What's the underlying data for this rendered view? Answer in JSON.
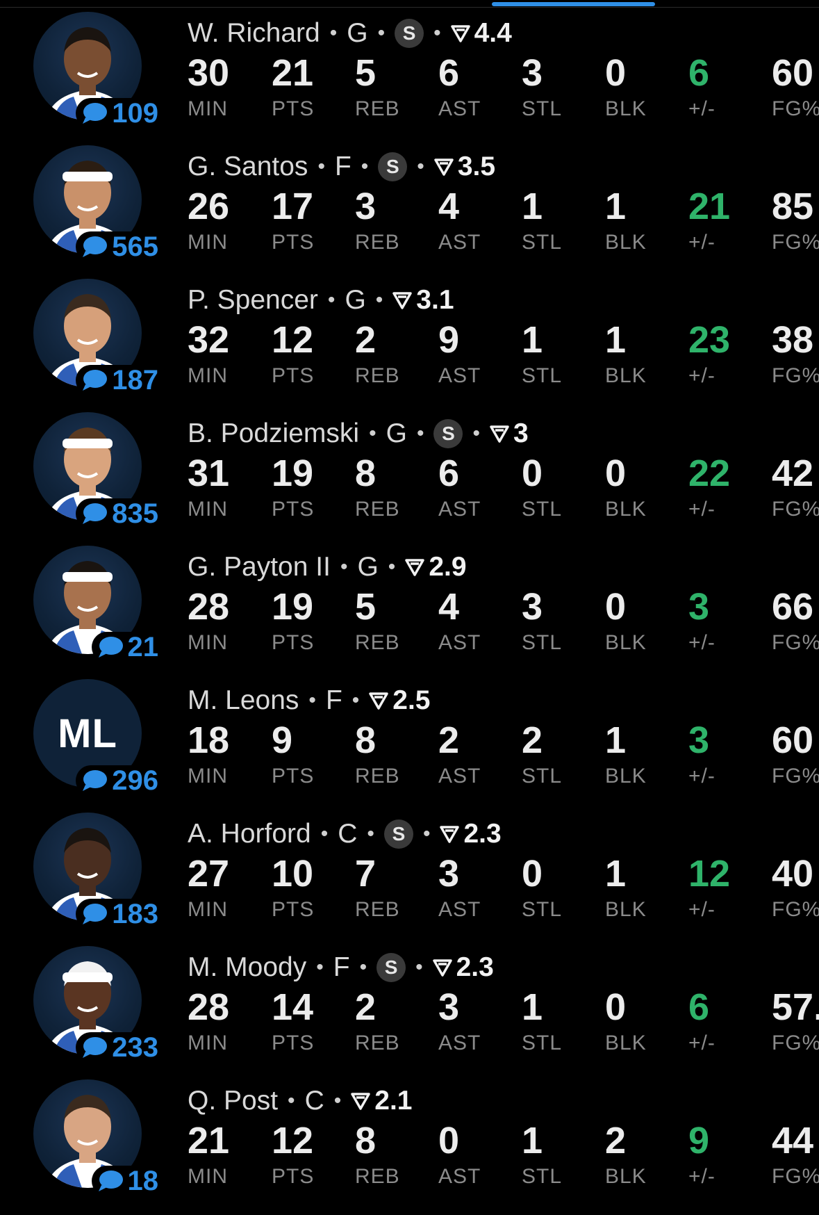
{
  "stat_labels": {
    "min": "MIN",
    "pts": "PTS",
    "reb": "REB",
    "ast": "AST",
    "stl": "STL",
    "blk": "BLK",
    "pm": "+/-",
    "fg": "FG%"
  },
  "colors": {
    "accent_blue": "#2f8fe6",
    "plus_minus_green": "#2fb36a",
    "background": "#000000"
  },
  "players": [
    {
      "name": "W. Richard",
      "pos": "G",
      "starter": true,
      "starter_label": "S",
      "rating": "4.4",
      "comments": "109",
      "initials": "",
      "min": "30",
      "pts": "21",
      "reb": "5",
      "ast": "6",
      "stl": "3",
      "blk": "0",
      "pm": "6",
      "fg": "60"
    },
    {
      "name": "G. Santos",
      "pos": "F",
      "starter": true,
      "starter_label": "S",
      "rating": "3.5",
      "comments": "565",
      "initials": "",
      "min": "26",
      "pts": "17",
      "reb": "3",
      "ast": "4",
      "stl": "1",
      "blk": "1",
      "pm": "21",
      "fg": "85"
    },
    {
      "name": "P. Spencer",
      "pos": "G",
      "starter": false,
      "starter_label": "",
      "rating": "3.1",
      "comments": "187",
      "initials": "",
      "min": "32",
      "pts": "12",
      "reb": "2",
      "ast": "9",
      "stl": "1",
      "blk": "1",
      "pm": "23",
      "fg": "38"
    },
    {
      "name": "B. Podziemski",
      "pos": "G",
      "starter": true,
      "starter_label": "S",
      "rating": "3",
      "comments": "835",
      "initials": "",
      "min": "31",
      "pts": "19",
      "reb": "8",
      "ast": "6",
      "stl": "0",
      "blk": "0",
      "pm": "22",
      "fg": "42"
    },
    {
      "name": "G. Payton II",
      "pos": "G",
      "starter": false,
      "starter_label": "",
      "rating": "2.9",
      "comments": "21",
      "initials": "",
      "min": "28",
      "pts": "19",
      "reb": "5",
      "ast": "4",
      "stl": "3",
      "blk": "0",
      "pm": "3",
      "fg": "66"
    },
    {
      "name": "M. Leons",
      "pos": "F",
      "starter": false,
      "starter_label": "",
      "rating": "2.5",
      "comments": "296",
      "initials": "ML",
      "min": "18",
      "pts": "9",
      "reb": "8",
      "ast": "2",
      "stl": "2",
      "blk": "1",
      "pm": "3",
      "fg": "60"
    },
    {
      "name": "A. Horford",
      "pos": "C",
      "starter": true,
      "starter_label": "S",
      "rating": "2.3",
      "comments": "183",
      "initials": "",
      "min": "27",
      "pts": "10",
      "reb": "7",
      "ast": "3",
      "stl": "0",
      "blk": "1",
      "pm": "12",
      "fg": "40"
    },
    {
      "name": "M. Moody",
      "pos": "F",
      "starter": true,
      "starter_label": "S",
      "rating": "2.3",
      "comments": "233",
      "initials": "",
      "min": "28",
      "pts": "14",
      "reb": "2",
      "ast": "3",
      "stl": "1",
      "blk": "0",
      "pm": "6",
      "fg": "57."
    },
    {
      "name": "Q. Post",
      "pos": "C",
      "starter": false,
      "starter_label": "",
      "rating": "2.1",
      "comments": "18",
      "initials": "",
      "min": "21",
      "pts": "12",
      "reb": "8",
      "ast": "0",
      "stl": "1",
      "blk": "2",
      "pm": "9",
      "fg": "44"
    }
  ]
}
